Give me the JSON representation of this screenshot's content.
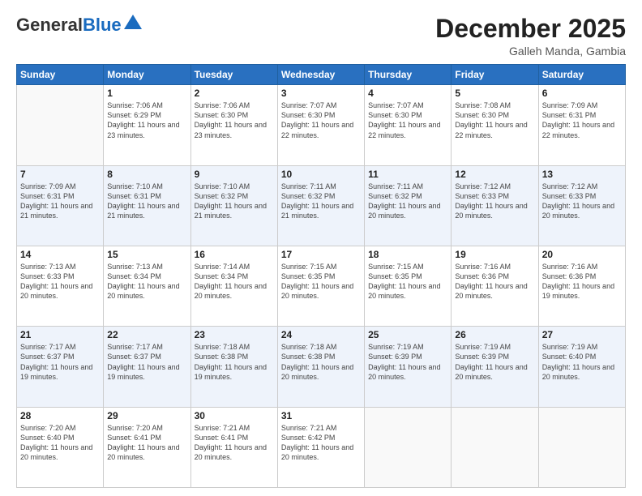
{
  "header": {
    "logo_general": "General",
    "logo_blue": "Blue",
    "month_title": "December 2025",
    "location": "Galleh Manda, Gambia"
  },
  "days_of_week": [
    "Sunday",
    "Monday",
    "Tuesday",
    "Wednesday",
    "Thursday",
    "Friday",
    "Saturday"
  ],
  "weeks": [
    [
      {
        "day": "",
        "sunrise": "",
        "sunset": "",
        "daylight": ""
      },
      {
        "day": "1",
        "sunrise": "Sunrise: 7:06 AM",
        "sunset": "Sunset: 6:29 PM",
        "daylight": "Daylight: 11 hours and 23 minutes."
      },
      {
        "day": "2",
        "sunrise": "Sunrise: 7:06 AM",
        "sunset": "Sunset: 6:30 PM",
        "daylight": "Daylight: 11 hours and 23 minutes."
      },
      {
        "day": "3",
        "sunrise": "Sunrise: 7:07 AM",
        "sunset": "Sunset: 6:30 PM",
        "daylight": "Daylight: 11 hours and 22 minutes."
      },
      {
        "day": "4",
        "sunrise": "Sunrise: 7:07 AM",
        "sunset": "Sunset: 6:30 PM",
        "daylight": "Daylight: 11 hours and 22 minutes."
      },
      {
        "day": "5",
        "sunrise": "Sunrise: 7:08 AM",
        "sunset": "Sunset: 6:30 PM",
        "daylight": "Daylight: 11 hours and 22 minutes."
      },
      {
        "day": "6",
        "sunrise": "Sunrise: 7:09 AM",
        "sunset": "Sunset: 6:31 PM",
        "daylight": "Daylight: 11 hours and 22 minutes."
      }
    ],
    [
      {
        "day": "7",
        "sunrise": "Sunrise: 7:09 AM",
        "sunset": "Sunset: 6:31 PM",
        "daylight": "Daylight: 11 hours and 21 minutes."
      },
      {
        "day": "8",
        "sunrise": "Sunrise: 7:10 AM",
        "sunset": "Sunset: 6:31 PM",
        "daylight": "Daylight: 11 hours and 21 minutes."
      },
      {
        "day": "9",
        "sunrise": "Sunrise: 7:10 AM",
        "sunset": "Sunset: 6:32 PM",
        "daylight": "Daylight: 11 hours and 21 minutes."
      },
      {
        "day": "10",
        "sunrise": "Sunrise: 7:11 AM",
        "sunset": "Sunset: 6:32 PM",
        "daylight": "Daylight: 11 hours and 21 minutes."
      },
      {
        "day": "11",
        "sunrise": "Sunrise: 7:11 AM",
        "sunset": "Sunset: 6:32 PM",
        "daylight": "Daylight: 11 hours and 20 minutes."
      },
      {
        "day": "12",
        "sunrise": "Sunrise: 7:12 AM",
        "sunset": "Sunset: 6:33 PM",
        "daylight": "Daylight: 11 hours and 20 minutes."
      },
      {
        "day": "13",
        "sunrise": "Sunrise: 7:12 AM",
        "sunset": "Sunset: 6:33 PM",
        "daylight": "Daylight: 11 hours and 20 minutes."
      }
    ],
    [
      {
        "day": "14",
        "sunrise": "Sunrise: 7:13 AM",
        "sunset": "Sunset: 6:33 PM",
        "daylight": "Daylight: 11 hours and 20 minutes."
      },
      {
        "day": "15",
        "sunrise": "Sunrise: 7:13 AM",
        "sunset": "Sunset: 6:34 PM",
        "daylight": "Daylight: 11 hours and 20 minutes."
      },
      {
        "day": "16",
        "sunrise": "Sunrise: 7:14 AM",
        "sunset": "Sunset: 6:34 PM",
        "daylight": "Daylight: 11 hours and 20 minutes."
      },
      {
        "day": "17",
        "sunrise": "Sunrise: 7:15 AM",
        "sunset": "Sunset: 6:35 PM",
        "daylight": "Daylight: 11 hours and 20 minutes."
      },
      {
        "day": "18",
        "sunrise": "Sunrise: 7:15 AM",
        "sunset": "Sunset: 6:35 PM",
        "daylight": "Daylight: 11 hours and 20 minutes."
      },
      {
        "day": "19",
        "sunrise": "Sunrise: 7:16 AM",
        "sunset": "Sunset: 6:36 PM",
        "daylight": "Daylight: 11 hours and 20 minutes."
      },
      {
        "day": "20",
        "sunrise": "Sunrise: 7:16 AM",
        "sunset": "Sunset: 6:36 PM",
        "daylight": "Daylight: 11 hours and 19 minutes."
      }
    ],
    [
      {
        "day": "21",
        "sunrise": "Sunrise: 7:17 AM",
        "sunset": "Sunset: 6:37 PM",
        "daylight": "Daylight: 11 hours and 19 minutes."
      },
      {
        "day": "22",
        "sunrise": "Sunrise: 7:17 AM",
        "sunset": "Sunset: 6:37 PM",
        "daylight": "Daylight: 11 hours and 19 minutes."
      },
      {
        "day": "23",
        "sunrise": "Sunrise: 7:18 AM",
        "sunset": "Sunset: 6:38 PM",
        "daylight": "Daylight: 11 hours and 19 minutes."
      },
      {
        "day": "24",
        "sunrise": "Sunrise: 7:18 AM",
        "sunset": "Sunset: 6:38 PM",
        "daylight": "Daylight: 11 hours and 20 minutes."
      },
      {
        "day": "25",
        "sunrise": "Sunrise: 7:19 AM",
        "sunset": "Sunset: 6:39 PM",
        "daylight": "Daylight: 11 hours and 20 minutes."
      },
      {
        "day": "26",
        "sunrise": "Sunrise: 7:19 AM",
        "sunset": "Sunset: 6:39 PM",
        "daylight": "Daylight: 11 hours and 20 minutes."
      },
      {
        "day": "27",
        "sunrise": "Sunrise: 7:19 AM",
        "sunset": "Sunset: 6:40 PM",
        "daylight": "Daylight: 11 hours and 20 minutes."
      }
    ],
    [
      {
        "day": "28",
        "sunrise": "Sunrise: 7:20 AM",
        "sunset": "Sunset: 6:40 PM",
        "daylight": "Daylight: 11 hours and 20 minutes."
      },
      {
        "day": "29",
        "sunrise": "Sunrise: 7:20 AM",
        "sunset": "Sunset: 6:41 PM",
        "daylight": "Daylight: 11 hours and 20 minutes."
      },
      {
        "day": "30",
        "sunrise": "Sunrise: 7:21 AM",
        "sunset": "Sunset: 6:41 PM",
        "daylight": "Daylight: 11 hours and 20 minutes."
      },
      {
        "day": "31",
        "sunrise": "Sunrise: 7:21 AM",
        "sunset": "Sunset: 6:42 PM",
        "daylight": "Daylight: 11 hours and 20 minutes."
      },
      {
        "day": "",
        "sunrise": "",
        "sunset": "",
        "daylight": ""
      },
      {
        "day": "",
        "sunrise": "",
        "sunset": "",
        "daylight": ""
      },
      {
        "day": "",
        "sunrise": "",
        "sunset": "",
        "daylight": ""
      }
    ]
  ]
}
